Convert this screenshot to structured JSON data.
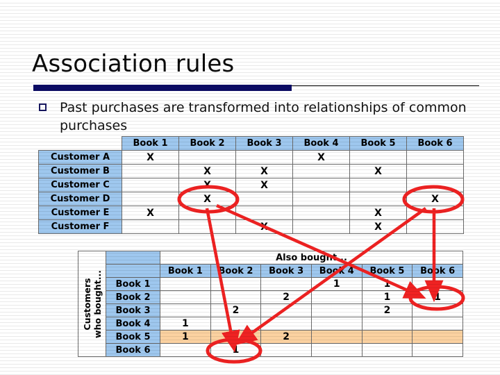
{
  "slide": {
    "title": "Association rules",
    "bullet_glyph": "square-bullet",
    "bullet_text": "Past purchases are transformed into relationships of common purchases",
    "accent_color": "#0d0d66",
    "header_fill": "#9ec7ee",
    "highlight_fill": "#fbd1a0",
    "annotation_color": "#ef2222"
  },
  "table_customers": {
    "corner_label": "",
    "columns": [
      "Book 1",
      "Book 2",
      "Book 3",
      "Book 4",
      "Book 5",
      "Book 6"
    ],
    "rows": [
      {
        "label": "Customer A",
        "cells": [
          "X",
          "",
          "",
          "X",
          "",
          ""
        ]
      },
      {
        "label": "Customer B",
        "cells": [
          "",
          "X",
          "X",
          "",
          "X",
          ""
        ]
      },
      {
        "label": "Customer C",
        "cells": [
          "",
          "X",
          "X",
          "",
          "",
          ""
        ]
      },
      {
        "label": "Customer D",
        "cells": [
          "",
          "X",
          "",
          "",
          "",
          "X"
        ]
      },
      {
        "label": "Customer E",
        "cells": [
          "X",
          "",
          "",
          "",
          "X",
          ""
        ]
      },
      {
        "label": "Customer F",
        "cells": [
          "",
          "",
          "X",
          "",
          "X",
          ""
        ]
      }
    ]
  },
  "table_cooccurrence": {
    "span_header": "Also bought...",
    "side_header": "Customers who bought...",
    "side_header_line1": "Customers",
    "side_header_line2": "who bought...",
    "columns": [
      "Book 1",
      "Book 2",
      "Book 3",
      "Book 4",
      "Book 5",
      "Book 6"
    ],
    "rows": [
      {
        "label": "Book 1",
        "highlighted": false,
        "cells": [
          "",
          "",
          "",
          "1",
          "1",
          ""
        ]
      },
      {
        "label": "Book 2",
        "highlighted": false,
        "cells": [
          "",
          "",
          "2",
          "",
          "1",
          "1"
        ]
      },
      {
        "label": "Book 3",
        "highlighted": false,
        "cells": [
          "",
          "2",
          "",
          "",
          "2",
          ""
        ]
      },
      {
        "label": "Book 4",
        "highlighted": false,
        "cells": [
          "1",
          "",
          "",
          "",
          "",
          ""
        ]
      },
      {
        "label": "Book 5",
        "highlighted": true,
        "cells": [
          "1",
          "1",
          "2",
          "",
          "",
          ""
        ]
      },
      {
        "label": "Book 6",
        "highlighted": false,
        "cells": [
          "",
          "1",
          "",
          "",
          "",
          ""
        ]
      }
    ]
  },
  "annotations": {
    "ellipses": [
      {
        "name": "ellipse-customer-d-book2",
        "target": "Customer D / Book 2 = X"
      },
      {
        "name": "ellipse-customer-d-book6",
        "target": "Customer D / Book 6 = X"
      },
      {
        "name": "ellipse-book2-book6",
        "target": "Book 2 row / Book 6 column = 1"
      },
      {
        "name": "ellipse-book6-book2",
        "target": "Book 6 row / Book 2 column = 1"
      }
    ],
    "arrows": [
      {
        "name": "arrow-d-book2-to-book6-book2",
        "from": "Customer D / Book 2",
        "to": "Book 6 row / Book 2 column"
      },
      {
        "name": "arrow-d-book2-to-book2-book6",
        "from": "Customer D / Book 2",
        "to": "Book 2 row / Book 6 column"
      },
      {
        "name": "arrow-d-book6-to-book2-book6",
        "from": "Customer D / Book 6",
        "to": "Book 2 row / Book 6 column"
      },
      {
        "name": "arrow-d-book6-to-book5-book2",
        "from": "Customer D / Book 6",
        "to": "Book 5 row / Book 2 column"
      }
    ]
  }
}
